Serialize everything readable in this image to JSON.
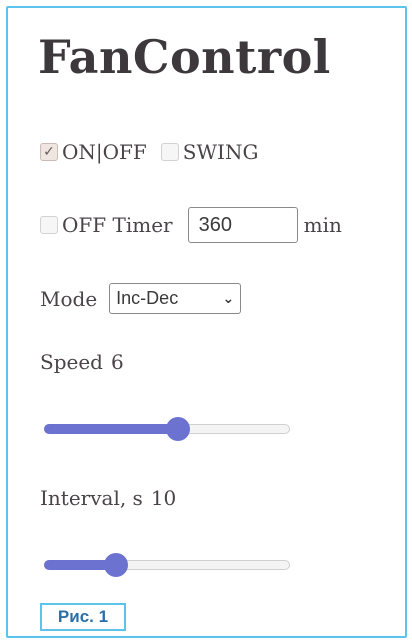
{
  "title": "FanControl",
  "controls": {
    "onoff": {
      "label": "ON|OFF",
      "checked": true
    },
    "swing": {
      "label": "SWING",
      "checked": false
    },
    "off_timer": {
      "label": "OFF Timer",
      "checked": false,
      "value": "360",
      "unit": "min"
    },
    "mode": {
      "label": "Mode",
      "selected": "Inc-Dec"
    },
    "speed": {
      "label": "Speed",
      "value": "6",
      "fraction": 0.55
    },
    "interval": {
      "label": "Interval, s",
      "value": "10",
      "fraction": 0.27
    }
  },
  "caption": "Рис. 1",
  "colors": {
    "accent": "#6b72d0",
    "frame": "#5cc3ea",
    "caption_text": "#2a6fa8"
  },
  "icons": {
    "check": "check-icon",
    "chevron": "chevron-down-icon"
  }
}
